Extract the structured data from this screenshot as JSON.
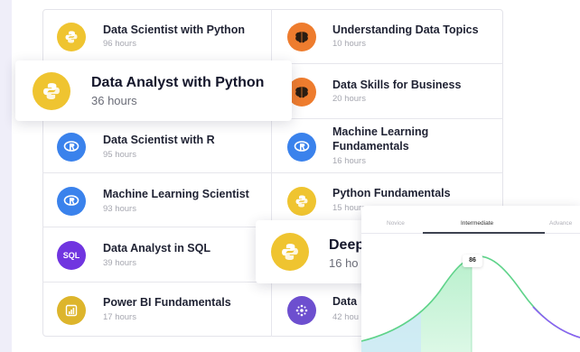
{
  "courses": {
    "left": [
      {
        "title": "Data Scientist with Python",
        "hours": "96 hours",
        "icon": "python-icon"
      },
      {
        "title": "Data Analyst with Python",
        "hours": "36 hours",
        "icon": "python-icon"
      },
      {
        "title": "Data Scientist with R",
        "hours": "95 hours",
        "icon": "r-icon"
      },
      {
        "title": "Machine Learning Scientist",
        "hours": "93 hours",
        "icon": "r-icon"
      },
      {
        "title": "Data Analyst in SQL",
        "hours": "39 hours",
        "icon": "sql-icon",
        "icon_text": "SQL"
      },
      {
        "title": "Power BI Fundamentals",
        "hours": "17 hours",
        "icon": "power-bi-icon"
      }
    ],
    "right": [
      {
        "title": "Understanding Data Topics",
        "hours": "10 hours",
        "icon": "brain-icon"
      },
      {
        "title": "Data Skills for Business",
        "hours": "20 hours",
        "icon": "brain-icon"
      },
      {
        "title_line1": "Machine Learning",
        "title_line2": "Fundamentals",
        "hours": "16 hours",
        "icon": "r-icon"
      },
      {
        "title": "Python Fundamentals",
        "hours": "15 hours",
        "icon": "python-icon"
      },
      {
        "title": "Deep",
        "hours": "16 ho",
        "icon": "python-icon"
      },
      {
        "title": "Data",
        "hours": "42 hou",
        "icon": "network-icon"
      }
    ]
  },
  "featured": {
    "title": "Data Analyst with Python",
    "hours": "36 hours"
  },
  "featured2": {
    "title": "Deep",
    "hours": "16 ho"
  },
  "skill_chart": {
    "tabs": [
      "Novice",
      "Intermediate",
      "Advance"
    ],
    "active_tab": "Intermediate",
    "score": "86"
  },
  "colors": {
    "python": "#efc430",
    "r": "#3a82ec",
    "sql": "#7035e0",
    "brain": "#ee7c2e",
    "curve_green": "#5fd38a",
    "curve_purple": "#8b5cf6"
  }
}
